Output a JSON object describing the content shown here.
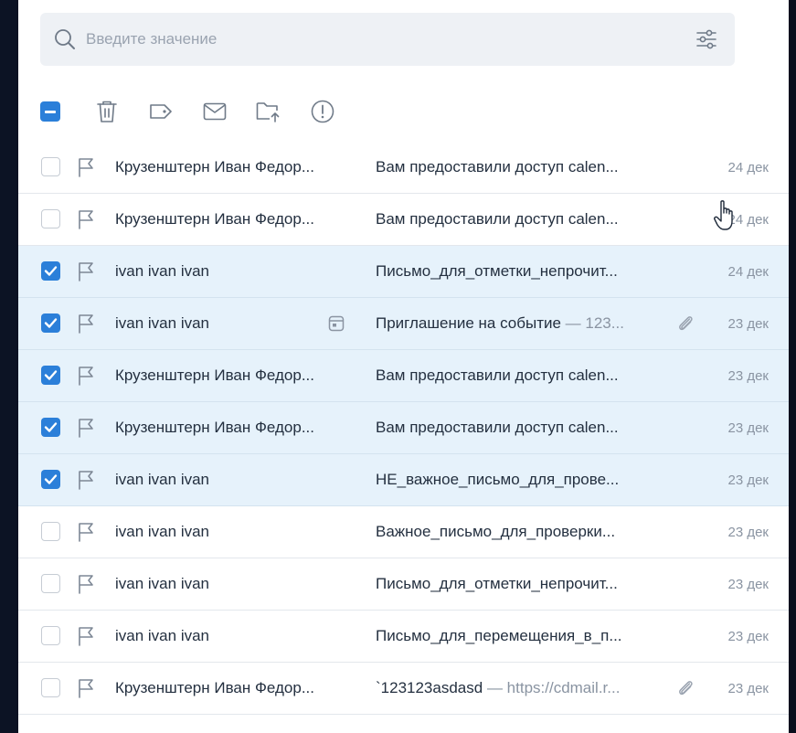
{
  "search": {
    "placeholder": "Введите значение"
  },
  "toolbar": {
    "select_all_state": "partial",
    "actions": [
      "trash-icon",
      "tag-icon",
      "envelope-icon",
      "folder-move-icon",
      "alert-icon"
    ]
  },
  "colors": {
    "accent": "#2b7fd9",
    "selected_row": "#e6f2fb",
    "muted_text": "#8a94a2"
  },
  "messages": [
    {
      "sender": "Крузенштерн Иван Федор...",
      "subject": "Вам предоставили доступ calen...",
      "snippet": "",
      "date": "24 дек",
      "selected": false,
      "invite": false,
      "attachment": false
    },
    {
      "sender": "Крузенштерн Иван Федор...",
      "subject": "Вам предоставили доступ calen...",
      "snippet": "",
      "date": "24 дек",
      "selected": false,
      "invite": false,
      "attachment": false
    },
    {
      "sender": "ivan ivan ivan",
      "subject": "Письмо_для_отметки_непрочит...",
      "snippet": "",
      "date": "24 дек",
      "selected": true,
      "invite": false,
      "attachment": false
    },
    {
      "sender": "ivan ivan ivan",
      "subject": "Приглашение на событие",
      "snippet": " — 123...",
      "date": "23 дек",
      "selected": true,
      "invite": true,
      "attachment": true
    },
    {
      "sender": "Крузенштерн Иван Федор...",
      "subject": "Вам предоставили доступ calen...",
      "snippet": "",
      "date": "23 дек",
      "selected": true,
      "invite": false,
      "attachment": false
    },
    {
      "sender": "Крузенштерн Иван Федор...",
      "subject": "Вам предоставили доступ calen...",
      "snippet": "",
      "date": "23 дек",
      "selected": true,
      "invite": false,
      "attachment": false
    },
    {
      "sender": "ivan ivan ivan",
      "subject": "НЕ_важное_письмо_для_прове...",
      "snippet": "",
      "date": "23 дек",
      "selected": true,
      "invite": false,
      "attachment": false
    },
    {
      "sender": "ivan ivan ivan",
      "subject": "Важное_письмо_для_проверки...",
      "snippet": "",
      "date": "23 дек",
      "selected": false,
      "invite": false,
      "attachment": false
    },
    {
      "sender": "ivan ivan ivan",
      "subject": "Письмо_для_отметки_непрочит...",
      "snippet": "",
      "date": "23 дек",
      "selected": false,
      "invite": false,
      "attachment": false
    },
    {
      "sender": "ivan ivan ivan",
      "subject": "Письмо_для_перемещения_в_п...",
      "snippet": "",
      "date": "23 дек",
      "selected": false,
      "invite": false,
      "attachment": false
    },
    {
      "sender": "Крузенштерн Иван Федор...",
      "subject": "`123123asdasd",
      "snippet": " — https://cdmail.r...",
      "date": "23 дек",
      "selected": false,
      "invite": false,
      "attachment": true
    }
  ]
}
